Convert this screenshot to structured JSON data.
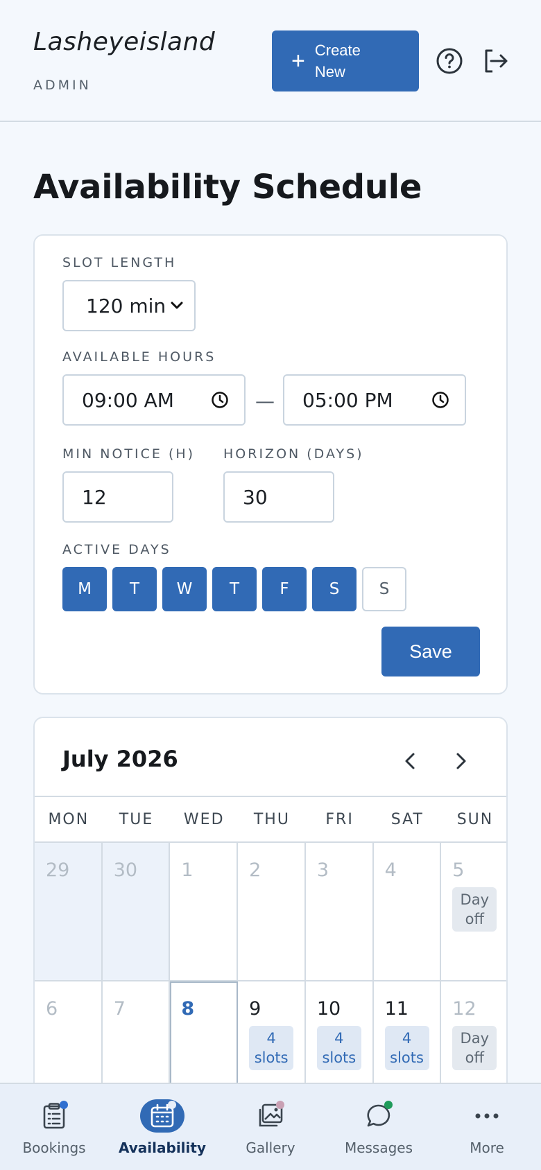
{
  "header": {
    "brand": "Lasheyeisland",
    "role": "ADMIN",
    "create_plus": "+",
    "create_label": "Create New"
  },
  "page": {
    "title": "Availability Schedule"
  },
  "settings": {
    "slot_length_label": "SLOT LENGTH",
    "slot_length_value": "120 min",
    "available_hours_label": "AVAILABLE HOURS",
    "start_time": "09:00 AM",
    "separator": "—",
    "end_time": "05:00 PM",
    "min_notice_label": "MIN NOTICE (H)",
    "min_notice_value": "12",
    "horizon_label": "HORIZON (DAYS)",
    "horizon_value": "30",
    "active_days_label": "ACTIVE DAYS",
    "days": [
      {
        "label": "M",
        "active": true
      },
      {
        "label": "T",
        "active": true
      },
      {
        "label": "W",
        "active": true
      },
      {
        "label": "T",
        "active": true
      },
      {
        "label": "F",
        "active": true
      },
      {
        "label": "S",
        "active": true
      },
      {
        "label": "S",
        "active": false
      }
    ],
    "save_label": "Save"
  },
  "calendar": {
    "month_label": "July 2026",
    "weekdays": [
      "MON",
      "TUE",
      "WED",
      "THU",
      "FRI",
      "SAT",
      "SUN"
    ],
    "cells": [
      {
        "day": "29",
        "state": "prevmonth",
        "badge": null
      },
      {
        "day": "30",
        "state": "prevmonth",
        "badge": null
      },
      {
        "day": "1",
        "state": "past",
        "badge": null
      },
      {
        "day": "2",
        "state": "past",
        "badge": null
      },
      {
        "day": "3",
        "state": "past",
        "badge": null
      },
      {
        "day": "4",
        "state": "past",
        "badge": null
      },
      {
        "day": "5",
        "state": "past",
        "badge": {
          "type": "dayoff",
          "line1": "Day",
          "line2": "off"
        }
      },
      {
        "day": "6",
        "state": "past",
        "badge": null
      },
      {
        "day": "7",
        "state": "past",
        "badge": null
      },
      {
        "day": "8",
        "state": "today",
        "badge": null
      },
      {
        "day": "9",
        "state": "active",
        "badge": {
          "type": "slots",
          "line1": "4",
          "line2": "slots"
        }
      },
      {
        "day": "10",
        "state": "active",
        "badge": {
          "type": "slots",
          "line1": "4",
          "line2": "slots"
        }
      },
      {
        "day": "11",
        "state": "active",
        "badge": {
          "type": "slots",
          "line1": "4",
          "line2": "slots"
        }
      },
      {
        "day": "12",
        "state": "past",
        "badge": {
          "type": "dayoff",
          "line1": "Day",
          "line2": "off"
        }
      }
    ]
  },
  "bottom_nav": [
    {
      "label": "Bookings",
      "icon": "clipboard-icon",
      "active": false,
      "dot": "#2f6fd0"
    },
    {
      "label": "Availability",
      "icon": "calendar-icon",
      "active": true,
      "dot": "#e8eff9"
    },
    {
      "label": "Gallery",
      "icon": "gallery-icon",
      "active": false,
      "dot": "#c9a0b4"
    },
    {
      "label": "Messages",
      "icon": "chat-icon",
      "active": false,
      "dot": "#1f9b5b"
    },
    {
      "label": "More",
      "icon": "more-icon",
      "active": false,
      "dot": null
    }
  ],
  "colors": {
    "accent": "#316ab5",
    "background": "#f4f8fd",
    "nav_bg": "#e8eff9"
  }
}
